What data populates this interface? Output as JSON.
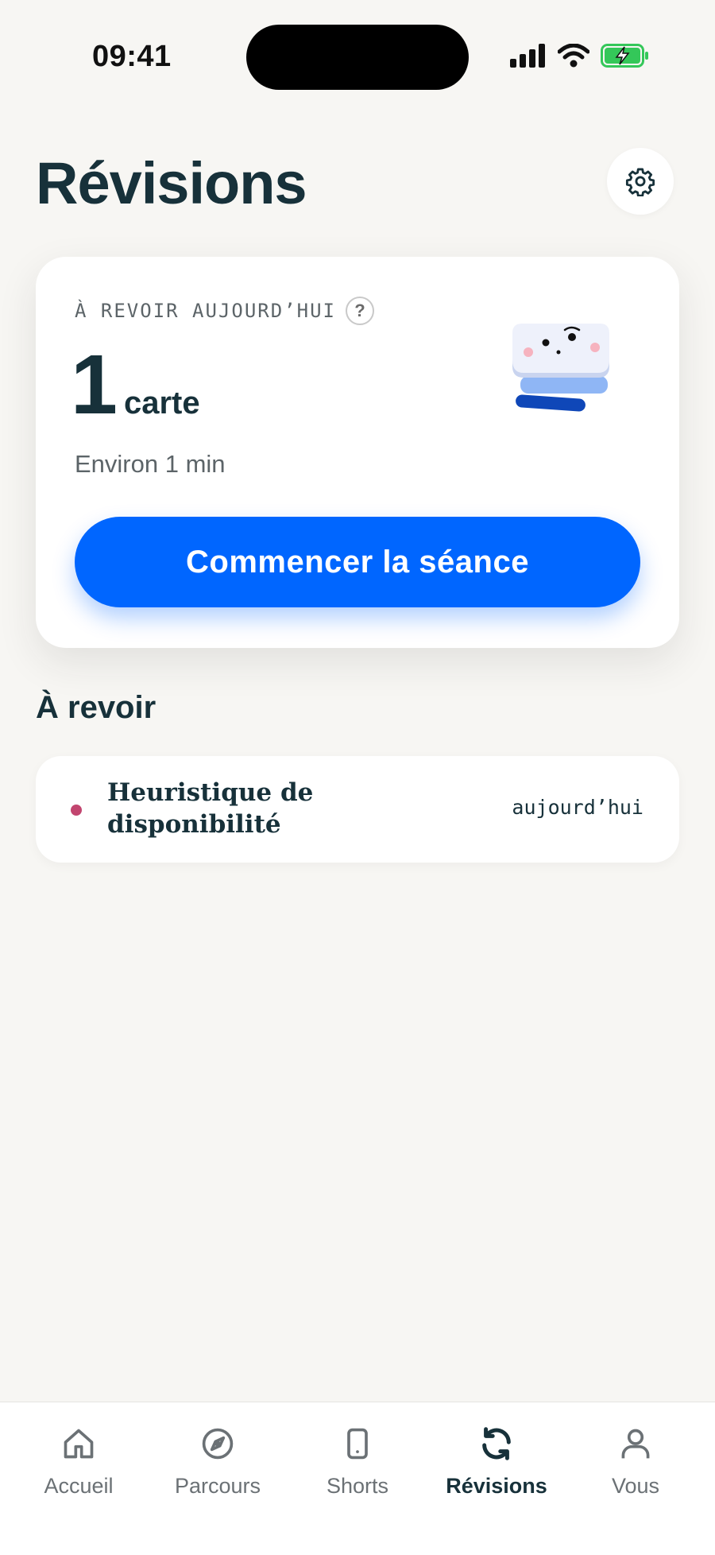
{
  "status_bar": {
    "time": "09:41"
  },
  "header": {
    "title": "Révisions"
  },
  "today_card": {
    "label": "À REVOIR AUJOURD’HUI",
    "help_glyph": "?",
    "count": "1",
    "unit": "carte",
    "duration": "Environ 1 min",
    "start_label": "Commencer la séance"
  },
  "section": {
    "title": "À revoir"
  },
  "review_items": [
    {
      "title": "Heuristique de disponibilité",
      "due": "aujourd’hui",
      "dot_color": "#c2456f"
    }
  ],
  "tabs": [
    {
      "label": "Accueil",
      "icon": "home-icon",
      "active": false
    },
    {
      "label": "Parcours",
      "icon": "compass-icon",
      "active": false
    },
    {
      "label": "Shorts",
      "icon": "phone-icon",
      "active": false
    },
    {
      "label": "Révisions",
      "icon": "refresh-icon",
      "active": true
    },
    {
      "label": "Vous",
      "icon": "person-icon",
      "active": false
    }
  ],
  "colors": {
    "accent": "#0066ff",
    "text": "#17313a",
    "background": "#f7f6f3"
  }
}
